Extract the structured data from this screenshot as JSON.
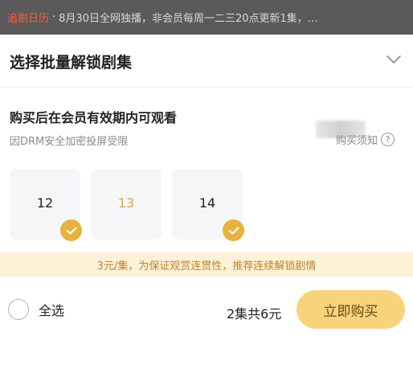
{
  "banner": {
    "tag": "追剧日历",
    "separator": "·",
    "text": "8月30日全网独播，非会员每周一二三20点更新1集，…"
  },
  "sheet": {
    "title": "选择批量解锁剧集",
    "collapse_icon": "chevron-down-icon"
  },
  "info": {
    "title": "购买后在会员有效期内可观看",
    "subtitle": "因DRM安全加密投屏受限",
    "notice_label": "购买须知",
    "notice_icon": "?"
  },
  "episodes": [
    {
      "number": "12",
      "selected": true
    },
    {
      "number": "13",
      "selected": false
    },
    {
      "number": "14",
      "selected": true
    }
  ],
  "promo": {
    "text": "3元/集，为保证观赏连贯性，推荐连续解锁剧情"
  },
  "footer": {
    "select_all_label": "全选",
    "total": "2集共6元",
    "buy_label": "立即购买"
  },
  "colors": {
    "accent": "#e8b23e",
    "buy_button": "#f7d37b",
    "promo_bg": "#fdf1d8",
    "banner_tag": "#ff5a3c"
  }
}
